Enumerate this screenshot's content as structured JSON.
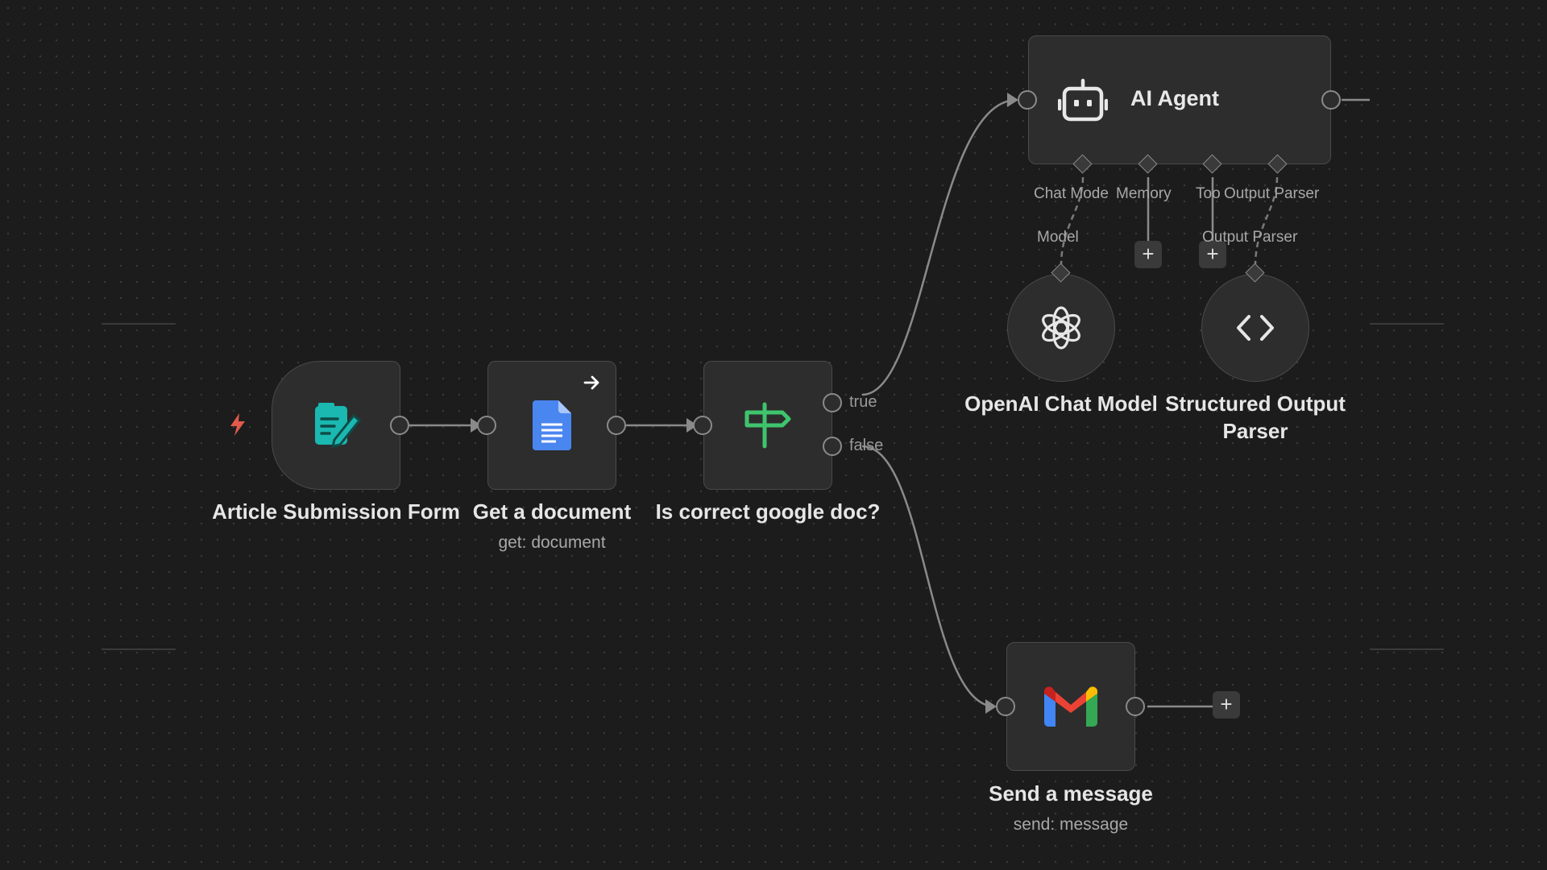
{
  "canvas": {
    "background": "#1c1c1c",
    "accent_trigger": "#e0594a"
  },
  "nodes": {
    "form": {
      "title": "Article Submission Form",
      "icon": "form-edit-icon"
    },
    "get_doc": {
      "title": "Get a document",
      "subtitle": "get: document",
      "icon": "google-docs-icon"
    },
    "if_node": {
      "title": "Is correct google doc?",
      "icon": "signpost-icon",
      "outputs": [
        "true",
        "false"
      ]
    },
    "agent": {
      "title": "AI Agent",
      "icon": "robot-icon",
      "connectors": [
        "Chat Model",
        "Memory",
        "Tool",
        "Output Parser"
      ],
      "connector_labels_shown": [
        "Chat Mode",
        "Memory",
        "Too",
        "Output Parser"
      ]
    },
    "openai": {
      "title": "OpenAI Chat Model",
      "icon": "openai-icon",
      "connector_label": "Model"
    },
    "parser": {
      "title_line1": "Structured Output",
      "title_line2": "Parser",
      "icon": "code-brackets-icon",
      "connector_label": "Output Parser"
    },
    "gmail": {
      "title": "Send a message",
      "subtitle": "send: message",
      "icon": "gmail-icon"
    }
  },
  "add_button_label": "+"
}
